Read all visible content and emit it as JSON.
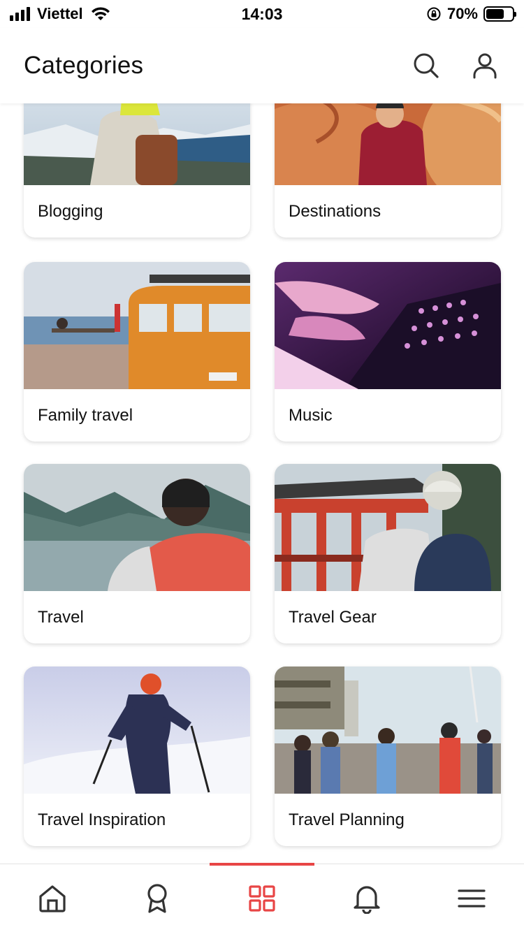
{
  "status_bar": {
    "carrier": "Viettel",
    "time": "14:03",
    "battery_percent": "70%",
    "battery_level": 0.7
  },
  "header": {
    "title": "Categories",
    "icons": [
      "search-icon",
      "user-icon"
    ]
  },
  "categories": [
    {
      "label": "Blogging"
    },
    {
      "label": "Destinations"
    },
    {
      "label": "Family travel"
    },
    {
      "label": "Music"
    },
    {
      "label": "Travel"
    },
    {
      "label": "Travel Gear"
    },
    {
      "label": "Travel Inspiration"
    },
    {
      "label": "Travel Planning"
    }
  ],
  "bottom_nav": {
    "items": [
      "home-icon",
      "award-icon",
      "grid-icon",
      "bell-icon",
      "menu-icon"
    ],
    "active": "grid-icon"
  },
  "colors": {
    "accent": "#e84545",
    "icon": "#333333"
  }
}
